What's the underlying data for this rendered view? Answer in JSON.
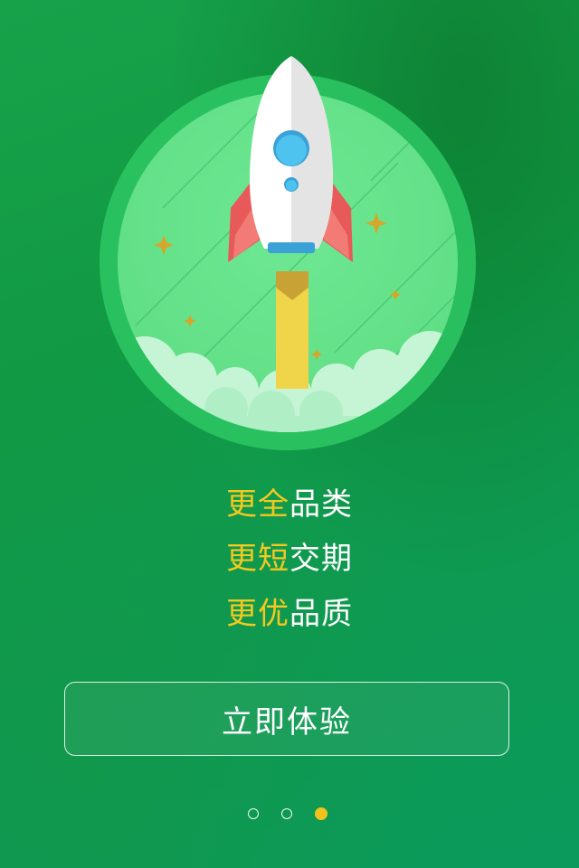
{
  "tagline": {
    "line1": {
      "highlight": "更全",
      "rest": "品类"
    },
    "line2": {
      "highlight": "更短",
      "rest": "交期"
    },
    "line3": {
      "highlight": "更优",
      "rest": "品质"
    }
  },
  "cta": {
    "label": "立即体验"
  },
  "pager": {
    "total": 3,
    "active_index": 2
  },
  "colors": {
    "background": "#119a43",
    "highlight_text": "#f4c91f",
    "pager_active": "#f4c21a",
    "rocket_fin": "#e85a5a",
    "rocket_window": "#4ec3f0",
    "exhaust": "#f0d54a"
  },
  "illustration": {
    "subject": "rocket-launch",
    "icons": [
      "rocket-icon",
      "sparkle-icon",
      "cloud-icon"
    ]
  }
}
